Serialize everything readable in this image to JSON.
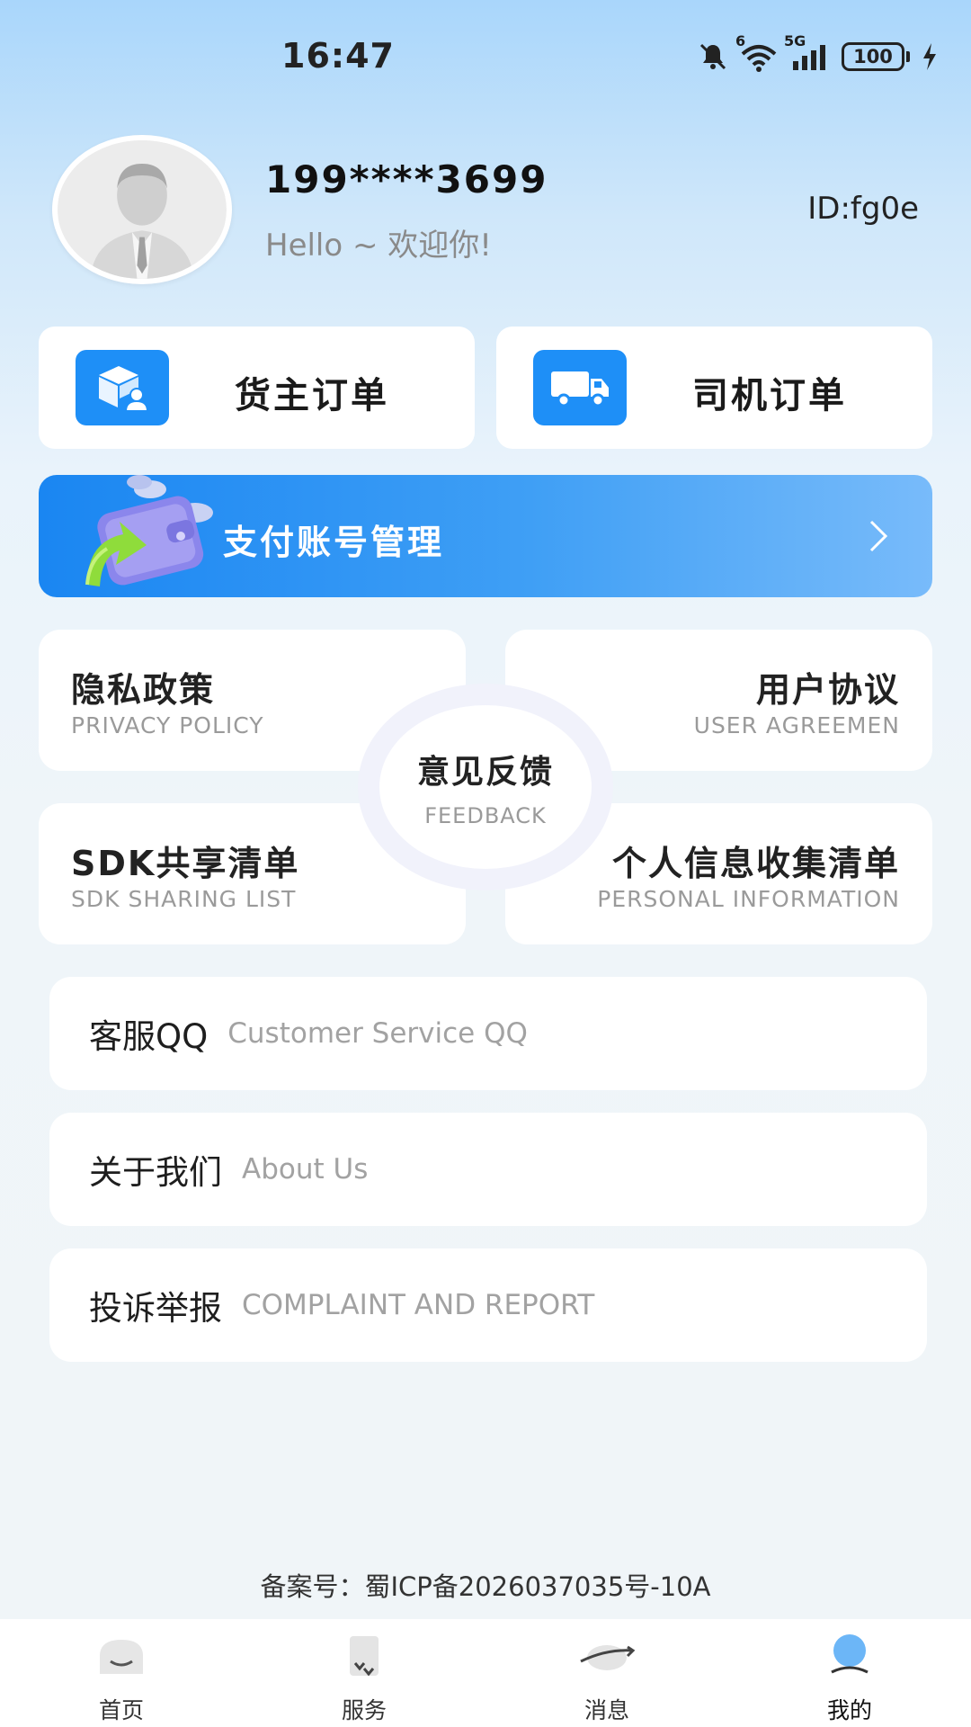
{
  "status_bar": {
    "time": "16:47",
    "battery": "100",
    "network": "5G",
    "wifi_badge": "6",
    "icons": [
      "mute-bell-icon",
      "wifi-icon",
      "signal-icon",
      "battery-icon",
      "charging-icon"
    ]
  },
  "profile": {
    "phone": "199****3699",
    "greeting": "Hello ~ 欢迎你!",
    "id": "ID:fg0e"
  },
  "orders": [
    {
      "label": "货主订单",
      "icon": "cargo-owner-icon"
    },
    {
      "label": "司机订单",
      "icon": "truck-icon"
    }
  ],
  "pay_banner": {
    "label": "支付账号管理",
    "icon": "wallet-icon"
  },
  "policies": {
    "privacy": {
      "title": "隐私政策",
      "sub": "PRIVACY POLICY"
    },
    "agreement": {
      "title": "用户协议",
      "sub": "USER AGREEMEN"
    },
    "sdk": {
      "title": "SDK共享清单",
      "sub": "SDK SHARING LIST"
    },
    "personal": {
      "title": "个人信息收集清单",
      "sub": "PERSONAL INFORMATION"
    },
    "feedback": {
      "title": "意见反馈",
      "sub": "FEEDBACK"
    }
  },
  "list": {
    "qq": {
      "title": "客服QQ",
      "sub": "Customer Service QQ"
    },
    "about": {
      "title": "关于我们",
      "sub": "About Us"
    },
    "report": {
      "title": "投诉举报",
      "sub": "COMPLAINT AND REPORT"
    }
  },
  "icp": "备案号：蜀ICP备2026037035号-10A",
  "bottom_nav": [
    {
      "label": "首页",
      "icon": "home-icon"
    },
    {
      "label": "服务",
      "icon": "service-icon"
    },
    {
      "label": "消息",
      "icon": "message-icon"
    },
    {
      "label": "我的",
      "icon": "profile-icon",
      "active": true
    }
  ],
  "colors": {
    "accent": "#1e8ff7",
    "banner_start": "#1a86f2",
    "banner_end": "#78bbfa",
    "nav_active": "#6cb6f7"
  }
}
